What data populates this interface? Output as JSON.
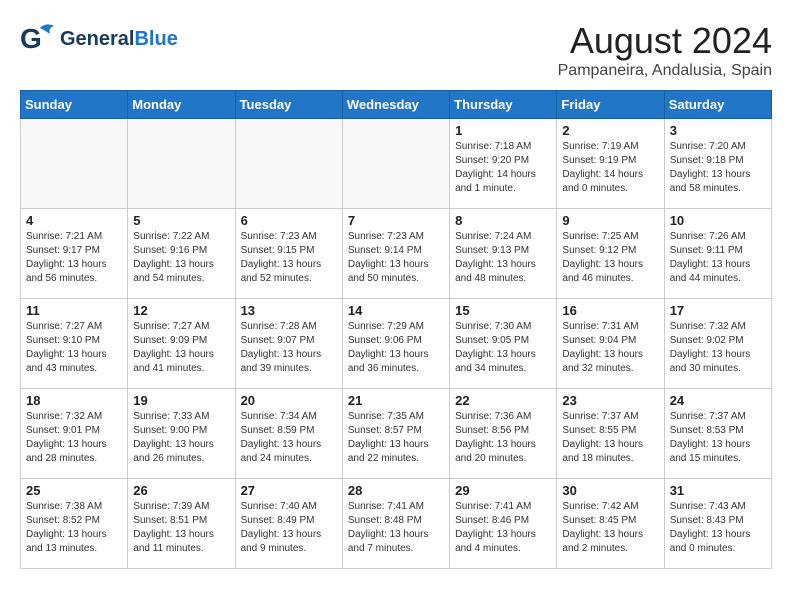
{
  "logo": {
    "general": "General",
    "blue": "Blue"
  },
  "title": "August 2024",
  "subtitle": "Pampaneira, Andalusia, Spain",
  "days_of_week": [
    "Sunday",
    "Monday",
    "Tuesday",
    "Wednesday",
    "Thursday",
    "Friday",
    "Saturday"
  ],
  "weeks": [
    [
      {
        "day": "",
        "info": ""
      },
      {
        "day": "",
        "info": ""
      },
      {
        "day": "",
        "info": ""
      },
      {
        "day": "",
        "info": ""
      },
      {
        "day": "1",
        "info": "Sunrise: 7:18 AM\nSunset: 9:20 PM\nDaylight: 14 hours\nand 1 minute."
      },
      {
        "day": "2",
        "info": "Sunrise: 7:19 AM\nSunset: 9:19 PM\nDaylight: 14 hours\nand 0 minutes."
      },
      {
        "day": "3",
        "info": "Sunrise: 7:20 AM\nSunset: 9:18 PM\nDaylight: 13 hours\nand 58 minutes."
      }
    ],
    [
      {
        "day": "4",
        "info": "Sunrise: 7:21 AM\nSunset: 9:17 PM\nDaylight: 13 hours\nand 56 minutes."
      },
      {
        "day": "5",
        "info": "Sunrise: 7:22 AM\nSunset: 9:16 PM\nDaylight: 13 hours\nand 54 minutes."
      },
      {
        "day": "6",
        "info": "Sunrise: 7:23 AM\nSunset: 9:15 PM\nDaylight: 13 hours\nand 52 minutes."
      },
      {
        "day": "7",
        "info": "Sunrise: 7:23 AM\nSunset: 9:14 PM\nDaylight: 13 hours\nand 50 minutes."
      },
      {
        "day": "8",
        "info": "Sunrise: 7:24 AM\nSunset: 9:13 PM\nDaylight: 13 hours\nand 48 minutes."
      },
      {
        "day": "9",
        "info": "Sunrise: 7:25 AM\nSunset: 9:12 PM\nDaylight: 13 hours\nand 46 minutes."
      },
      {
        "day": "10",
        "info": "Sunrise: 7:26 AM\nSunset: 9:11 PM\nDaylight: 13 hours\nand 44 minutes."
      }
    ],
    [
      {
        "day": "11",
        "info": "Sunrise: 7:27 AM\nSunset: 9:10 PM\nDaylight: 13 hours\nand 43 minutes."
      },
      {
        "day": "12",
        "info": "Sunrise: 7:27 AM\nSunset: 9:09 PM\nDaylight: 13 hours\nand 41 minutes."
      },
      {
        "day": "13",
        "info": "Sunrise: 7:28 AM\nSunset: 9:07 PM\nDaylight: 13 hours\nand 39 minutes."
      },
      {
        "day": "14",
        "info": "Sunrise: 7:29 AM\nSunset: 9:06 PM\nDaylight: 13 hours\nand 36 minutes."
      },
      {
        "day": "15",
        "info": "Sunrise: 7:30 AM\nSunset: 9:05 PM\nDaylight: 13 hours\nand 34 minutes."
      },
      {
        "day": "16",
        "info": "Sunrise: 7:31 AM\nSunset: 9:04 PM\nDaylight: 13 hours\nand 32 minutes."
      },
      {
        "day": "17",
        "info": "Sunrise: 7:32 AM\nSunset: 9:02 PM\nDaylight: 13 hours\nand 30 minutes."
      }
    ],
    [
      {
        "day": "18",
        "info": "Sunrise: 7:32 AM\nSunset: 9:01 PM\nDaylight: 13 hours\nand 28 minutes."
      },
      {
        "day": "19",
        "info": "Sunrise: 7:33 AM\nSunset: 9:00 PM\nDaylight: 13 hours\nand 26 minutes."
      },
      {
        "day": "20",
        "info": "Sunrise: 7:34 AM\nSunset: 8:59 PM\nDaylight: 13 hours\nand 24 minutes."
      },
      {
        "day": "21",
        "info": "Sunrise: 7:35 AM\nSunset: 8:57 PM\nDaylight: 13 hours\nand 22 minutes."
      },
      {
        "day": "22",
        "info": "Sunrise: 7:36 AM\nSunset: 8:56 PM\nDaylight: 13 hours\nand 20 minutes."
      },
      {
        "day": "23",
        "info": "Sunrise: 7:37 AM\nSunset: 8:55 PM\nDaylight: 13 hours\nand 18 minutes."
      },
      {
        "day": "24",
        "info": "Sunrise: 7:37 AM\nSunset: 8:53 PM\nDaylight: 13 hours\nand 15 minutes."
      }
    ],
    [
      {
        "day": "25",
        "info": "Sunrise: 7:38 AM\nSunset: 8:52 PM\nDaylight: 13 hours\nand 13 minutes."
      },
      {
        "day": "26",
        "info": "Sunrise: 7:39 AM\nSunset: 8:51 PM\nDaylight: 13 hours\nand 11 minutes."
      },
      {
        "day": "27",
        "info": "Sunrise: 7:40 AM\nSunset: 8:49 PM\nDaylight: 13 hours\nand 9 minutes."
      },
      {
        "day": "28",
        "info": "Sunrise: 7:41 AM\nSunset: 8:48 PM\nDaylight: 13 hours\nand 7 minutes."
      },
      {
        "day": "29",
        "info": "Sunrise: 7:41 AM\nSunset: 8:46 PM\nDaylight: 13 hours\nand 4 minutes."
      },
      {
        "day": "30",
        "info": "Sunrise: 7:42 AM\nSunset: 8:45 PM\nDaylight: 13 hours\nand 2 minutes."
      },
      {
        "day": "31",
        "info": "Sunrise: 7:43 AM\nSunset: 8:43 PM\nDaylight: 13 hours\nand 0 minutes."
      }
    ]
  ]
}
